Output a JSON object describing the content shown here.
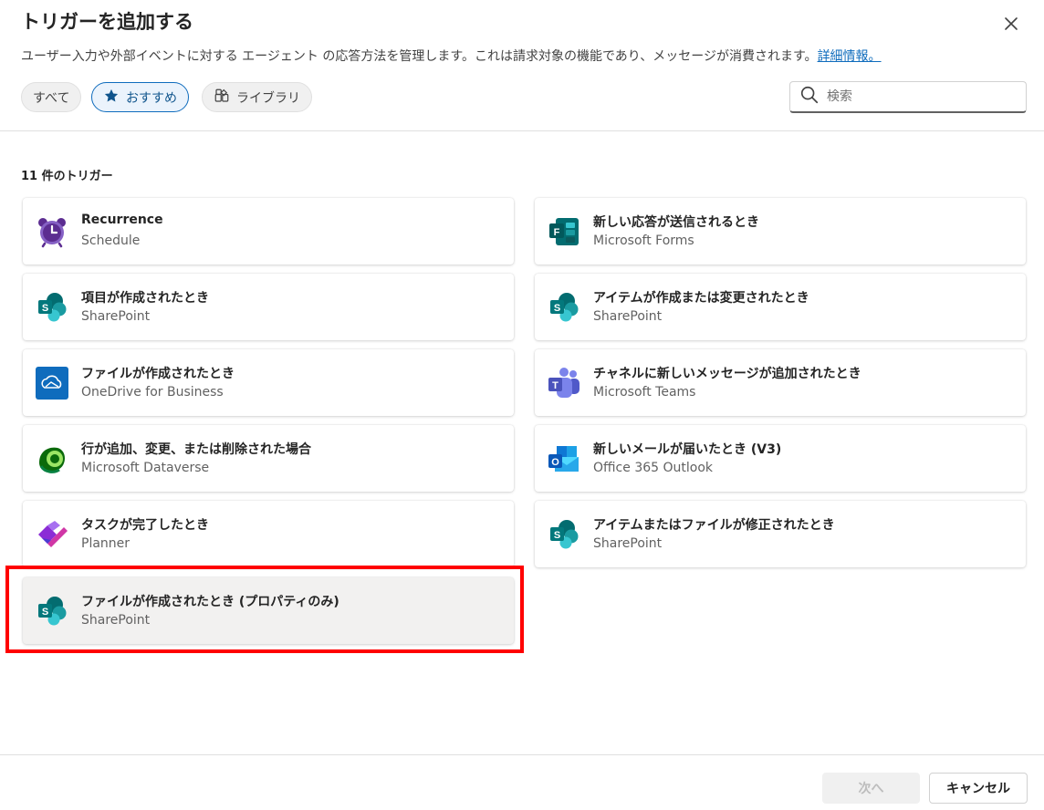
{
  "dialog": {
    "title": "トリガーを追加する",
    "description": "ユーザー入力や外部イベントに対する エージェント の応答方法を管理します。これは請求対象の機能であり、メッセージが消費されます。",
    "learn_more": "詳細情報。",
    "close_icon": "close-icon"
  },
  "filters": {
    "all": "すべて",
    "recommended": "おすすめ",
    "library": "ライブラリ",
    "selected": "recommended"
  },
  "search": {
    "placeholder": "検索",
    "value": ""
  },
  "results_count": "11 件のトリガー",
  "triggers": [
    {
      "title": "Recurrence",
      "connector": "Schedule",
      "icon": "alarm-clock-icon"
    },
    {
      "title": "新しい応答が送信されるとき",
      "connector": "Microsoft Forms",
      "icon": "forms-icon"
    },
    {
      "title": "項目が作成されたとき",
      "connector": "SharePoint",
      "icon": "sharepoint-icon"
    },
    {
      "title": "アイテムが作成または変更されたとき",
      "connector": "SharePoint",
      "icon": "sharepoint-icon"
    },
    {
      "title": "ファイルが作成されたとき",
      "connector": "OneDrive for Business",
      "icon": "onedrive-icon"
    },
    {
      "title": "チャネルに新しいメッセージが追加されたとき",
      "connector": "Microsoft Teams",
      "icon": "teams-icon"
    },
    {
      "title": "行が追加、変更、または削除された場合",
      "connector": "Microsoft Dataverse",
      "icon": "dataverse-icon"
    },
    {
      "title": "新しいメールが届いたとき (V3)",
      "connector": "Office 365 Outlook",
      "icon": "outlook-icon"
    },
    {
      "title": "タスクが完了したとき",
      "connector": "Planner",
      "icon": "planner-icon"
    },
    {
      "title": "アイテムまたはファイルが修正されたとき",
      "connector": "SharePoint",
      "icon": "sharepoint-icon"
    },
    {
      "title": "ファイルが作成されたとき (プロパティのみ)",
      "connector": "SharePoint",
      "icon": "sharepoint-icon",
      "selected": true
    }
  ],
  "footer": {
    "next": "次へ",
    "cancel": "キャンセル"
  },
  "colors": {
    "accent": "#0f6cbd",
    "highlight": "#ff0000"
  }
}
